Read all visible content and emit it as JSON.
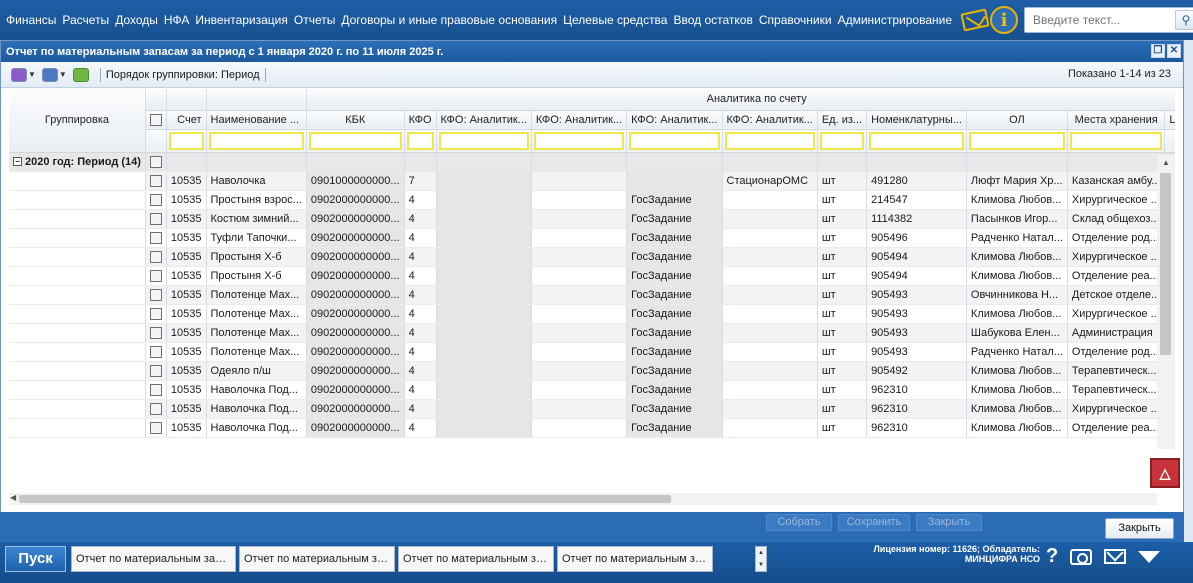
{
  "menu": [
    "Финансы",
    "Расчеты",
    "Доходы",
    "НФА",
    "Инвентаризация",
    "Отчеты",
    "Договоры и иные правовые основания",
    "Целевые средства",
    "Ввод остатков",
    "Справочники",
    "Администрирование"
  ],
  "search": {
    "placeholder": "Введите текст..."
  },
  "window": {
    "title": "Отчет по материальным запасам за период с 1 января 2020 г. по 11 июля 2025 г."
  },
  "toolbar": {
    "group_order_label": "Порядок группировки:",
    "group_order_value": "Период",
    "shown": "Показано 1-14 из 23"
  },
  "grid": {
    "group_header": "Группировка",
    "analytics_header": "Аналитика по счету",
    "columns": [
      "Счет",
      "Наименование ...",
      "КБК",
      "КФО",
      "КФО: Аналитик...",
      "КФО: Аналитик...",
      "КФО: Аналитик...",
      "КФО: Аналитик...",
      "Ед. из...",
      "Номенклатурны...",
      "ОЛ",
      "Места хранения",
      "Цена ("
    ],
    "group_row": "2020 год: Период (14)",
    "rows": [
      [
        "10535",
        "Наволочка",
        "0901000000000...",
        "7",
        "",
        "",
        "",
        "СтационарОМС",
        "шт",
        "491280",
        "Люфт Мария Хр...",
        "Казанская амбу..."
      ],
      [
        "10535",
        "Простыня взрос...",
        "0902000000000...",
        "4",
        "",
        "",
        "ГосЗадание",
        "",
        "шт",
        "214547",
        "Климова Любов...",
        "Хирургическое ..."
      ],
      [
        "10535",
        "Костюм зимний...",
        "0902000000000...",
        "4",
        "",
        "",
        "ГосЗадание",
        "",
        "шт",
        "1114382",
        "Пасынков Игор...",
        "Склад общехоз..."
      ],
      [
        "10535",
        "Туфли Тапочки...",
        "0902000000000...",
        "4",
        "",
        "",
        "ГосЗадание",
        "",
        "шт",
        "905496",
        "Радченко Натал...",
        "Отделение род..."
      ],
      [
        "10535",
        "Простыня Х-б",
        "0902000000000...",
        "4",
        "",
        "",
        "ГосЗадание",
        "",
        "шт",
        "905494",
        "Климова Любов...",
        "Хирургическое ..."
      ],
      [
        "10535",
        "Простыня Х-б",
        "0902000000000...",
        "4",
        "",
        "",
        "ГосЗадание",
        "",
        "шт",
        "905494",
        "Климова Любов...",
        "Отделение реа..."
      ],
      [
        "10535",
        "Полотенце Мах...",
        "0902000000000...",
        "4",
        "",
        "",
        "ГосЗадание",
        "",
        "шт",
        "905493",
        "Овчинникова Н...",
        "Детское отделе..."
      ],
      [
        "10535",
        "Полотенце Мах...",
        "0902000000000...",
        "4",
        "",
        "",
        "ГосЗадание",
        "",
        "шт",
        "905493",
        "Климова Любов...",
        "Хирургическое ..."
      ],
      [
        "10535",
        "Полотенце Мах...",
        "0902000000000...",
        "4",
        "",
        "",
        "ГосЗадание",
        "",
        "шт",
        "905493",
        "Шабукова Елен...",
        "Администрация"
      ],
      [
        "10535",
        "Полотенце Мах...",
        "0902000000000...",
        "4",
        "",
        "",
        "ГосЗадание",
        "",
        "шт",
        "905493",
        "Радченко Натал...",
        "Отделение род..."
      ],
      [
        "10535",
        "Одеяло п/ш",
        "0902000000000...",
        "4",
        "",
        "",
        "ГосЗадание",
        "",
        "шт",
        "905492",
        "Климова Любов...",
        "Терапевтическ..."
      ],
      [
        "10535",
        "Наволочка Под...",
        "0902000000000...",
        "4",
        "",
        "",
        "ГосЗадание",
        "",
        "шт",
        "962310",
        "Климова Любов...",
        "Терапевтическ..."
      ],
      [
        "10535",
        "Наволочка Под...",
        "0902000000000...",
        "4",
        "",
        "",
        "ГосЗадание",
        "",
        "шт",
        "962310",
        "Климова Любов...",
        "Хирургическое ..."
      ],
      [
        "10535",
        "Наволочка Под...",
        "0902000000000...",
        "4",
        "",
        "",
        "ГосЗадание",
        "",
        "шт",
        "962310",
        "Климова Любов...",
        "Отделение реа..."
      ]
    ]
  },
  "actions": {
    "collapse": "Собрать",
    "save": "Сохранить",
    "close_doc": "Закрыть",
    "close": "Закрыть"
  },
  "taskbar": {
    "start": "Пуск",
    "tasks": [
      "Отчет по материальным запасам",
      "Отчет по материальным запа...",
      "Отчет по материальным запа...",
      "Отчет по материальным запа..."
    ],
    "license_line1": "Лицензия номер: 11626; Обладатель:",
    "license_line2": "МИНЦИФРА НСО"
  },
  "icons": [
    "envelope-icon",
    "info-icon",
    "search-icon",
    "settings-icon",
    "print-icon",
    "refresh-icon",
    "question-icon",
    "camera-icon",
    "mail-icon",
    "arrow-down-icon"
  ]
}
